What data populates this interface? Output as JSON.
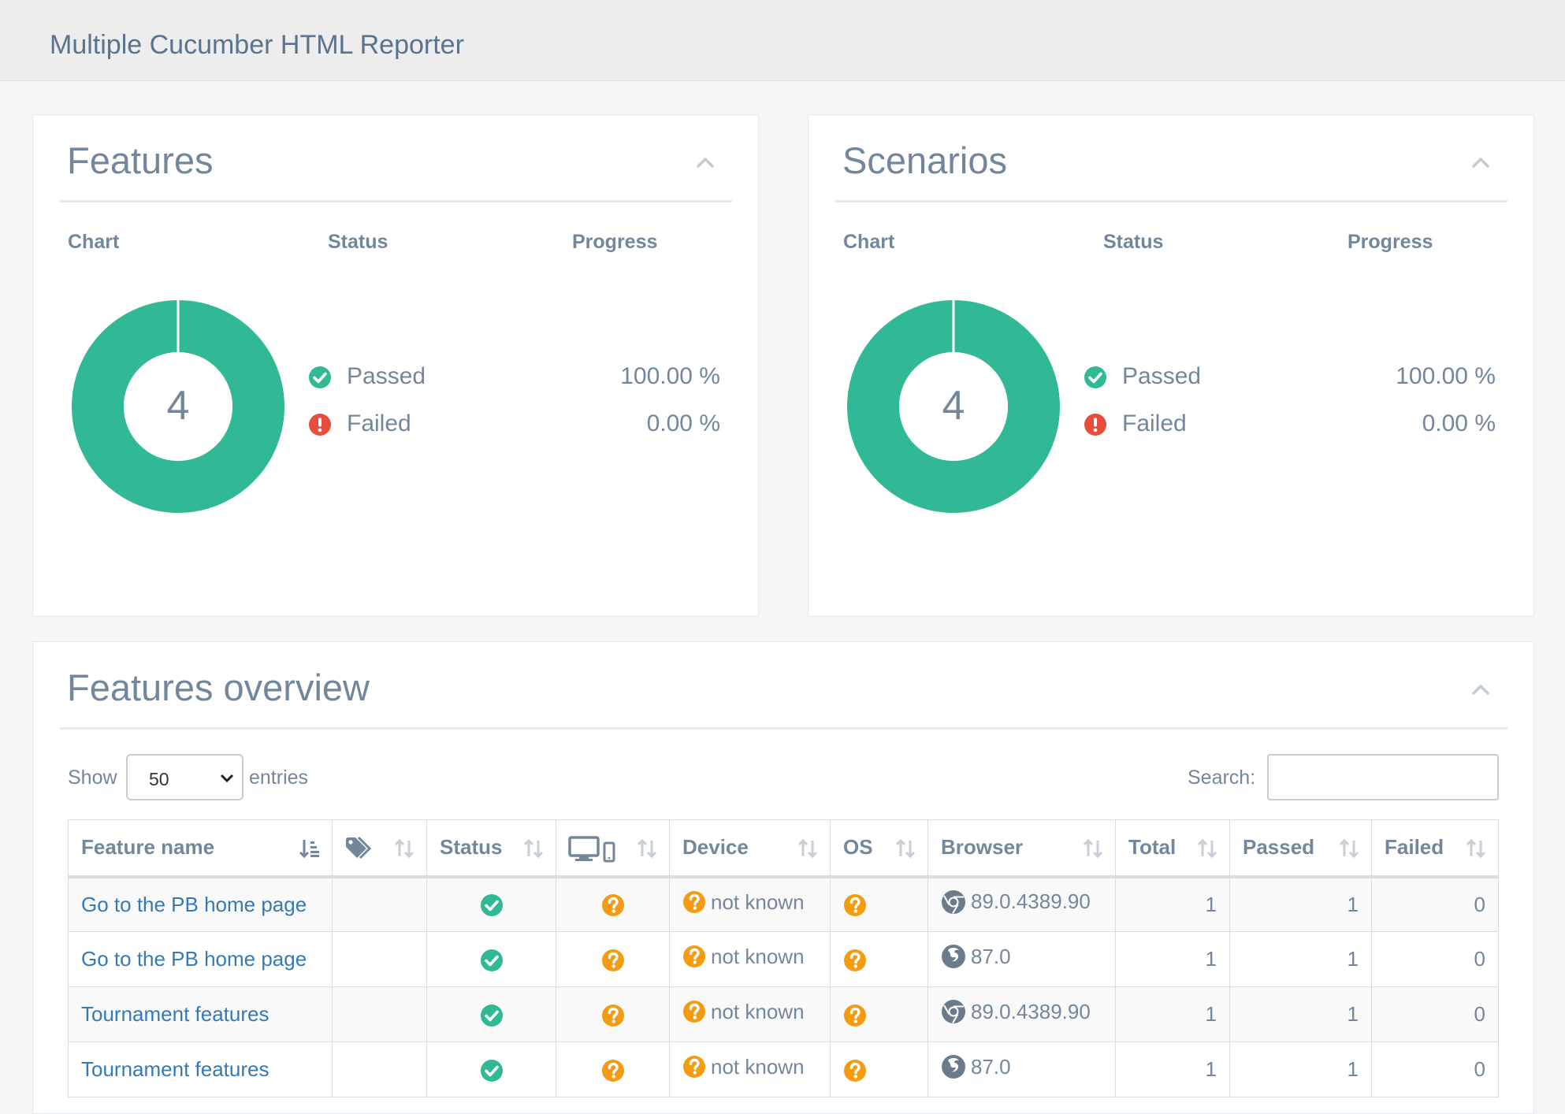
{
  "header": {
    "title": "Multiple Cucumber HTML Reporter"
  },
  "colors": {
    "passed": "#31b895",
    "failed": "#e74c3c",
    "unknown": "#f39c12",
    "link": "#337ab7",
    "text": "#73879c"
  },
  "features_panel": {
    "title": "Features",
    "col_chart": "Chart",
    "col_status": "Status",
    "col_progress": "Progress",
    "total": "4",
    "passed_label": "Passed",
    "passed_pct": "100.00 %",
    "failed_label": "Failed",
    "failed_pct": "0.00 %"
  },
  "scenarios_panel": {
    "title": "Scenarios",
    "col_chart": "Chart",
    "col_status": "Status",
    "col_progress": "Progress",
    "total": "4",
    "passed_label": "Passed",
    "passed_pct": "100.00 %",
    "failed_label": "Failed",
    "failed_pct": "0.00 %"
  },
  "overview": {
    "title": "Features overview",
    "show_label": "Show",
    "entries_value": "50",
    "entries_label": "entries",
    "search_label": "Search:",
    "columns": {
      "feature_name": "Feature name",
      "status": "Status",
      "device": "Device",
      "os": "OS",
      "browser": "Browser",
      "total": "Total",
      "passed": "Passed",
      "failed": "Failed"
    },
    "rows": [
      {
        "name": "Go to the PB home page",
        "device": "not known",
        "browser_version": "89.0.4389.90",
        "browser_icon": "chrome-icon",
        "total": "1",
        "passed": "1",
        "failed": "0"
      },
      {
        "name": "Go to the PB home page",
        "device": "not known",
        "browser_version": "87.0",
        "browser_icon": "firefox-icon",
        "total": "1",
        "passed": "1",
        "failed": "0"
      },
      {
        "name": "Tournament features",
        "device": "not known",
        "browser_version": "89.0.4389.90",
        "browser_icon": "chrome-icon",
        "total": "1",
        "passed": "1",
        "failed": "0"
      },
      {
        "name": "Tournament features",
        "device": "not known",
        "browser_version": "87.0",
        "browser_icon": "firefox-icon",
        "total": "1",
        "passed": "1",
        "failed": "0"
      }
    ]
  }
}
